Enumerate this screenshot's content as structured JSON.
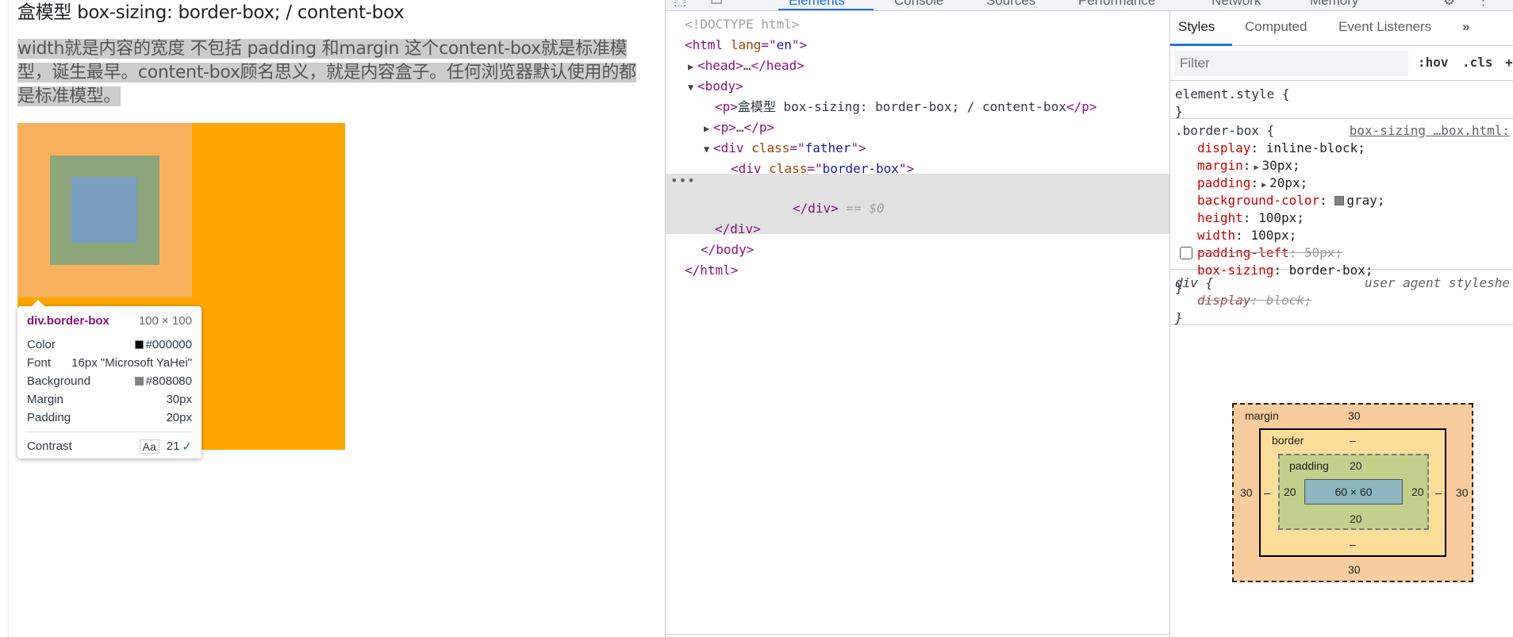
{
  "page": {
    "heading": "盒模型 box-sizing: border-box; / content-box",
    "paragraph": "width就是内容的宽度 不包括 padding 和margin 这个content-box就是标准模型，诞生最早。content-box顾名思义，就是内容盒子。任何浏览器默认使用的都是标准模型。"
  },
  "tooltip": {
    "name": "div.border-box",
    "size": "100 × 100",
    "rows": [
      {
        "label": "Color",
        "value": "#000000",
        "swatch": "#000000"
      },
      {
        "label": "Font",
        "value": "16px \"Microsoft YaHei\""
      },
      {
        "label": "Background",
        "value": "#808080",
        "swatch": "#808080"
      },
      {
        "label": "Margin",
        "value": "30px"
      },
      {
        "label": "Padding",
        "value": "20px"
      }
    ],
    "contrast_label": "Contrast",
    "contrast_aa": "Aa",
    "contrast_value": "21"
  },
  "devtools": {
    "top_tabs": [
      "Elements",
      "Console",
      "Sources",
      "Performance",
      "Network",
      "Memory"
    ],
    "dom": {
      "doctype": "<!DOCTYPE html>",
      "html_open": "html",
      "lang_attr": "lang",
      "lang_val": "en",
      "head": "head",
      "head_ellipsis": "…",
      "body": "body",
      "p1_text": "盒模型 box-sizing: border-box; / content-box",
      "p2_ellipsis": "…",
      "div_father_class": "father",
      "div_border_class": "border-box",
      "eq_sel": " == $0",
      "dots": "•••"
    },
    "styles_tabs": [
      "Styles",
      "Computed",
      "Event Listeners",
      "»"
    ],
    "filter_placeholder": "Filter",
    "hov": ":hov",
    "cls": ".cls",
    "element_style": "element.style {",
    "rule_selector": ".border-box {",
    "rule_source": "box-sizing …box.html:",
    "props": [
      {
        "name": "display",
        "value": "inline-block;"
      },
      {
        "name": "margin",
        "value": "30px;"
      },
      {
        "name": "padding",
        "value": "20px;"
      },
      {
        "name": "background-color",
        "value": "gray;"
      },
      {
        "name": "height",
        "value": "100px;"
      },
      {
        "name": "width",
        "value": "100px;"
      },
      {
        "name": "padding-left",
        "value": "50px;"
      },
      {
        "name": "box-sizing",
        "value": "border-box;"
      }
    ],
    "ua_selector": "div {",
    "ua_source": "user agent styleshe",
    "ua_prop": {
      "name": "display",
      "value": "block;"
    },
    "close_brace": "}"
  },
  "box_model": {
    "margin_label": "margin",
    "border_label": "border",
    "padding_label": "padding",
    "margin": {
      "top": "30",
      "right": "30",
      "bottom": "30",
      "left": "30"
    },
    "border": {
      "top": "–",
      "right": "–",
      "bottom": "–",
      "left": "–"
    },
    "padding": {
      "top": "20",
      "right": "20",
      "bottom": "20",
      "left": "20"
    },
    "content": "60 × 60"
  }
}
